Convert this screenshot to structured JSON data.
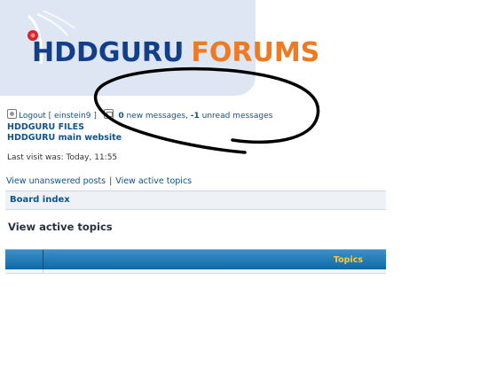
{
  "header": {
    "logo_text_1": "HDDGURU",
    "logo_text_2": "FORUMS",
    "colors": {
      "logo_blue": "#123f8a",
      "logo_orange": "#f07a22",
      "header_bg": "#dfe6f3"
    }
  },
  "userbar": {
    "logout_label": "Logout [ einstein9 ]",
    "msg_new_count": "0",
    "msg_new_label": " new messages, ",
    "msg_unread_count": "-1",
    "msg_unread_label": " unread messages"
  },
  "links": {
    "files": "HDDGURU FILES",
    "main_site": "HDDGURU main website"
  },
  "last_visit": "Last visit was: Today, 11:55",
  "quick_links": {
    "unanswered": "View unanswered posts",
    "separator": "|",
    "active": "View active topics"
  },
  "breadcrumb": {
    "board_index": "Board index"
  },
  "page_title": "View active topics",
  "table": {
    "col_topics": "Topics",
    "colors": {
      "head_top": "#3d8fc7",
      "head_bottom": "#0d6aa8",
      "topics_text": "#ffcc33"
    }
  }
}
